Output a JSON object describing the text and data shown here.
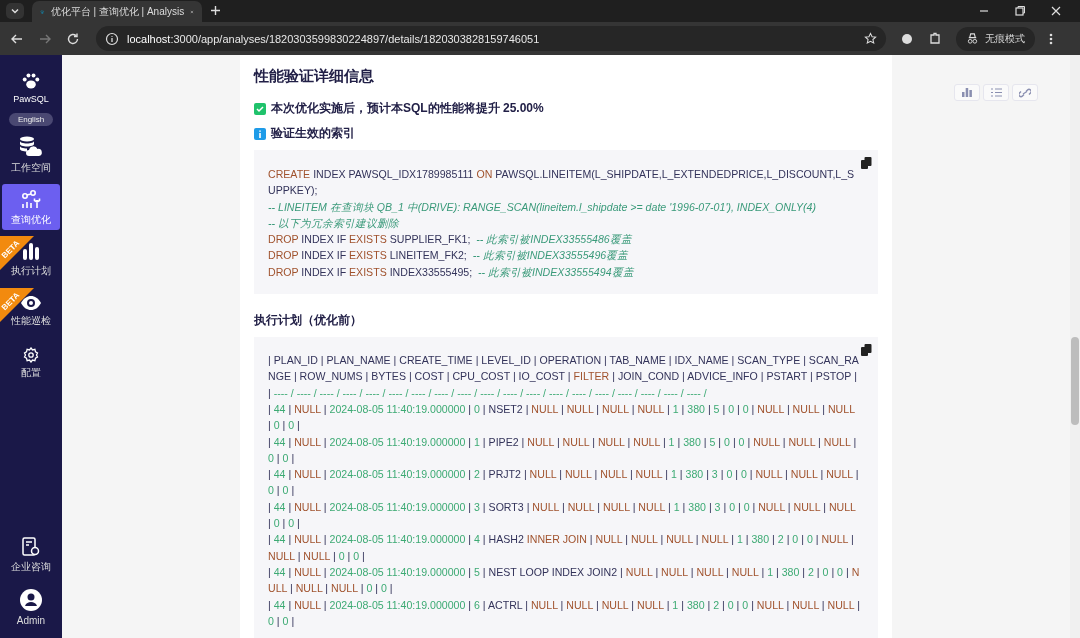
{
  "browser": {
    "tab_title": "优化平台 | 查询优化 | Analysis",
    "url_host": "localhost",
    "url_path": ":3000/app/analyses/1820303599830224897/details/1820303828159746051",
    "incognito_label": "无痕模式"
  },
  "sidebar": {
    "brand": "PawSQL",
    "language_button": "English",
    "items": [
      {
        "label": "工作空间",
        "selected": false
      },
      {
        "label": "查询优化",
        "selected": true
      },
      {
        "label": "执行计划",
        "selected": false,
        "badge": "BETA"
      },
      {
        "label": "性能巡检",
        "selected": false,
        "badge": "BETA"
      },
      {
        "label": "配置",
        "selected": false
      }
    ],
    "bottom_items": [
      {
        "label": "企业咨询"
      },
      {
        "label": "Admin"
      }
    ]
  },
  "content": {
    "title": "性能验证详细信息",
    "notices": [
      {
        "kind": "success",
        "text": "本次优化实施后，预计本SQL的性能将提升 25.00%"
      },
      {
        "kind": "info",
        "text": "验证生效的索引"
      }
    ],
    "index_sql": [
      [
        {
          "text": "CREATE",
          "kind": "keyword"
        },
        {
          "text": " INDEX PAWSQL_IDX1789985111 ",
          "kind": "plain"
        },
        {
          "text": "ON",
          "kind": "keyword"
        },
        {
          "text": " PAWSQL.LINEITEM(L_SHIPDATE,L_EXTENDEDPRICE,L_DISCOUNT,L_SUPPKEY);",
          "kind": "plain"
        }
      ],
      [
        {
          "text": "-- LINEITEM 在查询块 QB_1 中(DRIVE): RANGE_SCAN(lineitem.l_shipdate >= date '1996-07-01'), INDEX_ONLY(4)",
          "kind": "comment"
        }
      ],
      [
        {
          "text": "-- 以下为冗余索引建议删除",
          "kind": "comment"
        }
      ],
      [
        {
          "text": "DROP",
          "kind": "keyword"
        },
        {
          "text": " INDEX IF ",
          "kind": "plain"
        },
        {
          "text": "EXISTS",
          "kind": "keyword"
        },
        {
          "text": " SUPPLIER_FK1;  ",
          "kind": "plain"
        },
        {
          "text": "-- 此索引被INDEX33555486覆盖",
          "kind": "comment"
        }
      ],
      [
        {
          "text": "DROP",
          "kind": "keyword"
        },
        {
          "text": " INDEX IF ",
          "kind": "plain"
        },
        {
          "text": "EXISTS",
          "kind": "keyword"
        },
        {
          "text": " LINEITEM_FK2;  ",
          "kind": "plain"
        },
        {
          "text": "-- 此索引被INDEX33555496覆盖",
          "kind": "comment"
        }
      ],
      [
        {
          "text": "DROP",
          "kind": "keyword"
        },
        {
          "text": " INDEX IF ",
          "kind": "plain"
        },
        {
          "text": "EXISTS",
          "kind": "keyword"
        },
        {
          "text": " INDEX33555495;  ",
          "kind": "plain"
        },
        {
          "text": "-- 此索引被INDEX33555494覆盖",
          "kind": "comment"
        }
      ]
    ],
    "plan_title": "执行计划（优化前）",
    "plan_lines": [
      [
        {
          "text": "| PLAN_ID | PLAN_NAME | CREATE_TIME | LEVEL_ID | OPERATION | TAB_NAME | IDX_NAME | SCAN_TYPE | SCAN_RANGE | ROW_NUMS | BYTES | COST | CPU_COST | IO_COST | ",
          "kind": "plain"
        },
        {
          "text": "FILTER",
          "kind": "keyword"
        },
        {
          "text": " | JOIN_COND | ADVICE_INFO | PSTART | PSTOP |",
          "kind": "plain"
        }
      ],
      [
        {
          "text": "| ",
          "kind": "plain"
        },
        {
          "text": "---- / ---- / ---- / ---- / ---- / ---- / ---- / ---- / ---- / ---- / ---- / ---- / ---- / ---- / ---- / ---- / ---- / ---- / ---- /",
          "kind": "number"
        }
      ],
      [
        {
          "text": "| ",
          "kind": "plain"
        },
        {
          "text": "44",
          "kind": "number"
        },
        {
          "text": " | ",
          "kind": "plain"
        },
        {
          "text": "NULL",
          "kind": "keyword"
        },
        {
          "text": " | ",
          "kind": "plain"
        },
        {
          "text": "2024-08-05 11:40:19.000000",
          "kind": "number"
        },
        {
          "text": " | ",
          "kind": "plain"
        },
        {
          "text": "0",
          "kind": "number"
        },
        {
          "text": " | NSET2 | ",
          "kind": "plain"
        },
        {
          "text": "NULL",
          "kind": "keyword"
        },
        {
          "text": " | ",
          "kind": "plain"
        },
        {
          "text": "NULL",
          "kind": "keyword"
        },
        {
          "text": " | ",
          "kind": "plain"
        },
        {
          "text": "NULL",
          "kind": "keyword"
        },
        {
          "text": " | ",
          "kind": "plain"
        },
        {
          "text": "NULL",
          "kind": "keyword"
        },
        {
          "text": " | ",
          "kind": "plain"
        },
        {
          "text": "1",
          "kind": "number"
        },
        {
          "text": " | ",
          "kind": "plain"
        },
        {
          "text": "380",
          "kind": "number"
        },
        {
          "text": " | ",
          "kind": "plain"
        },
        {
          "text": "5",
          "kind": "number"
        },
        {
          "text": " | ",
          "kind": "plain"
        },
        {
          "text": "0",
          "kind": "number"
        },
        {
          "text": " | ",
          "kind": "plain"
        },
        {
          "text": "0",
          "kind": "number"
        },
        {
          "text": " | ",
          "kind": "plain"
        },
        {
          "text": "NULL",
          "kind": "keyword"
        },
        {
          "text": " | ",
          "kind": "plain"
        },
        {
          "text": "NULL",
          "kind": "keyword"
        },
        {
          "text": " | ",
          "kind": "plain"
        },
        {
          "text": "NULL",
          "kind": "keyword"
        },
        {
          "text": " | ",
          "kind": "plain"
        },
        {
          "text": "0",
          "kind": "number"
        },
        {
          "text": " | ",
          "kind": "plain"
        },
        {
          "text": "0",
          "kind": "number"
        },
        {
          "text": " |",
          "kind": "plain"
        }
      ],
      [
        {
          "text": "| ",
          "kind": "plain"
        },
        {
          "text": "44",
          "kind": "number"
        },
        {
          "text": " | ",
          "kind": "plain"
        },
        {
          "text": "NULL",
          "kind": "keyword"
        },
        {
          "text": " | ",
          "kind": "plain"
        },
        {
          "text": "2024-08-05 11:40:19.000000",
          "kind": "number"
        },
        {
          "text": " | ",
          "kind": "plain"
        },
        {
          "text": "1",
          "kind": "number"
        },
        {
          "text": " | PIPE2 | ",
          "kind": "plain"
        },
        {
          "text": "NULL",
          "kind": "keyword"
        },
        {
          "text": " | ",
          "kind": "plain"
        },
        {
          "text": "NULL",
          "kind": "keyword"
        },
        {
          "text": " | ",
          "kind": "plain"
        },
        {
          "text": "NULL",
          "kind": "keyword"
        },
        {
          "text": " | ",
          "kind": "plain"
        },
        {
          "text": "NULL",
          "kind": "keyword"
        },
        {
          "text": " | ",
          "kind": "plain"
        },
        {
          "text": "1",
          "kind": "number"
        },
        {
          "text": " | ",
          "kind": "plain"
        },
        {
          "text": "380",
          "kind": "number"
        },
        {
          "text": " | ",
          "kind": "plain"
        },
        {
          "text": "5",
          "kind": "number"
        },
        {
          "text": " | ",
          "kind": "plain"
        },
        {
          "text": "0",
          "kind": "number"
        },
        {
          "text": " | ",
          "kind": "plain"
        },
        {
          "text": "0",
          "kind": "number"
        },
        {
          "text": " | ",
          "kind": "plain"
        },
        {
          "text": "NULL",
          "kind": "keyword"
        },
        {
          "text": " | ",
          "kind": "plain"
        },
        {
          "text": "NULL",
          "kind": "keyword"
        },
        {
          "text": " | ",
          "kind": "plain"
        },
        {
          "text": "NULL",
          "kind": "keyword"
        },
        {
          "text": " | ",
          "kind": "plain"
        },
        {
          "text": "0",
          "kind": "number"
        },
        {
          "text": " | ",
          "kind": "plain"
        },
        {
          "text": "0",
          "kind": "number"
        },
        {
          "text": " |",
          "kind": "plain"
        }
      ],
      [
        {
          "text": "| ",
          "kind": "plain"
        },
        {
          "text": "44",
          "kind": "number"
        },
        {
          "text": " | ",
          "kind": "plain"
        },
        {
          "text": "NULL",
          "kind": "keyword"
        },
        {
          "text": " | ",
          "kind": "plain"
        },
        {
          "text": "2024-08-05 11:40:19.000000",
          "kind": "number"
        },
        {
          "text": " | ",
          "kind": "plain"
        },
        {
          "text": "2",
          "kind": "number"
        },
        {
          "text": " | PRJT2 | ",
          "kind": "plain"
        },
        {
          "text": "NULL",
          "kind": "keyword"
        },
        {
          "text": " | ",
          "kind": "plain"
        },
        {
          "text": "NULL",
          "kind": "keyword"
        },
        {
          "text": " | ",
          "kind": "plain"
        },
        {
          "text": "NULL",
          "kind": "keyword"
        },
        {
          "text": " | ",
          "kind": "plain"
        },
        {
          "text": "NULL",
          "kind": "keyword"
        },
        {
          "text": " | ",
          "kind": "plain"
        },
        {
          "text": "1",
          "kind": "number"
        },
        {
          "text": " | ",
          "kind": "plain"
        },
        {
          "text": "380",
          "kind": "number"
        },
        {
          "text": " | ",
          "kind": "plain"
        },
        {
          "text": "3",
          "kind": "number"
        },
        {
          "text": " | ",
          "kind": "plain"
        },
        {
          "text": "0",
          "kind": "number"
        },
        {
          "text": " | ",
          "kind": "plain"
        },
        {
          "text": "0",
          "kind": "number"
        },
        {
          "text": " | ",
          "kind": "plain"
        },
        {
          "text": "NULL",
          "kind": "keyword"
        },
        {
          "text": " | ",
          "kind": "plain"
        },
        {
          "text": "NULL",
          "kind": "keyword"
        },
        {
          "text": " | ",
          "kind": "plain"
        },
        {
          "text": "NULL",
          "kind": "keyword"
        },
        {
          "text": " | ",
          "kind": "plain"
        },
        {
          "text": "0",
          "kind": "number"
        },
        {
          "text": " | ",
          "kind": "plain"
        },
        {
          "text": "0",
          "kind": "number"
        },
        {
          "text": " |",
          "kind": "plain"
        }
      ],
      [
        {
          "text": "| ",
          "kind": "plain"
        },
        {
          "text": "44",
          "kind": "number"
        },
        {
          "text": " | ",
          "kind": "plain"
        },
        {
          "text": "NULL",
          "kind": "keyword"
        },
        {
          "text": " | ",
          "kind": "plain"
        },
        {
          "text": "2024-08-05 11:40:19.000000",
          "kind": "number"
        },
        {
          "text": " | ",
          "kind": "plain"
        },
        {
          "text": "3",
          "kind": "number"
        },
        {
          "text": " | SORT3 | ",
          "kind": "plain"
        },
        {
          "text": "NULL",
          "kind": "keyword"
        },
        {
          "text": " | ",
          "kind": "plain"
        },
        {
          "text": "NULL",
          "kind": "keyword"
        },
        {
          "text": " | ",
          "kind": "plain"
        },
        {
          "text": "NULL",
          "kind": "keyword"
        },
        {
          "text": " | ",
          "kind": "plain"
        },
        {
          "text": "NULL",
          "kind": "keyword"
        },
        {
          "text": " | ",
          "kind": "plain"
        },
        {
          "text": "1",
          "kind": "number"
        },
        {
          "text": " | ",
          "kind": "plain"
        },
        {
          "text": "380",
          "kind": "number"
        },
        {
          "text": " | ",
          "kind": "plain"
        },
        {
          "text": "3",
          "kind": "number"
        },
        {
          "text": " | ",
          "kind": "plain"
        },
        {
          "text": "0",
          "kind": "number"
        },
        {
          "text": " | ",
          "kind": "plain"
        },
        {
          "text": "0",
          "kind": "number"
        },
        {
          "text": " | ",
          "kind": "plain"
        },
        {
          "text": "NULL",
          "kind": "keyword"
        },
        {
          "text": " | ",
          "kind": "plain"
        },
        {
          "text": "NULL",
          "kind": "keyword"
        },
        {
          "text": " | ",
          "kind": "plain"
        },
        {
          "text": "NULL",
          "kind": "keyword"
        },
        {
          "text": " | ",
          "kind": "plain"
        },
        {
          "text": "0",
          "kind": "number"
        },
        {
          "text": " | ",
          "kind": "plain"
        },
        {
          "text": "0",
          "kind": "number"
        },
        {
          "text": " |",
          "kind": "plain"
        }
      ],
      [
        {
          "text": "| ",
          "kind": "plain"
        },
        {
          "text": "44",
          "kind": "number"
        },
        {
          "text": " | ",
          "kind": "plain"
        },
        {
          "text": "NULL",
          "kind": "keyword"
        },
        {
          "text": " | ",
          "kind": "plain"
        },
        {
          "text": "2024-08-05 11:40:19.000000",
          "kind": "number"
        },
        {
          "text": " | ",
          "kind": "plain"
        },
        {
          "text": "4",
          "kind": "number"
        },
        {
          "text": " | HASH2 ",
          "kind": "plain"
        },
        {
          "text": "INNER JOIN",
          "kind": "keyword"
        },
        {
          "text": " | ",
          "kind": "plain"
        },
        {
          "text": "NULL",
          "kind": "keyword"
        },
        {
          "text": " | ",
          "kind": "plain"
        },
        {
          "text": "NULL",
          "kind": "keyword"
        },
        {
          "text": " | ",
          "kind": "plain"
        },
        {
          "text": "NULL",
          "kind": "keyword"
        },
        {
          "text": " | ",
          "kind": "plain"
        },
        {
          "text": "NULL",
          "kind": "keyword"
        },
        {
          "text": " | ",
          "kind": "plain"
        },
        {
          "text": "1",
          "kind": "number"
        },
        {
          "text": " | ",
          "kind": "plain"
        },
        {
          "text": "380",
          "kind": "number"
        },
        {
          "text": " | ",
          "kind": "plain"
        },
        {
          "text": "2",
          "kind": "number"
        },
        {
          "text": " | ",
          "kind": "plain"
        },
        {
          "text": "0",
          "kind": "number"
        },
        {
          "text": " | ",
          "kind": "plain"
        },
        {
          "text": "0",
          "kind": "number"
        },
        {
          "text": " | ",
          "kind": "plain"
        },
        {
          "text": "NULL",
          "kind": "keyword"
        },
        {
          "text": " | ",
          "kind": "plain"
        },
        {
          "text": "NULL",
          "kind": "keyword"
        },
        {
          "text": " | ",
          "kind": "plain"
        },
        {
          "text": "NULL",
          "kind": "keyword"
        },
        {
          "text": " | ",
          "kind": "plain"
        },
        {
          "text": "0",
          "kind": "number"
        },
        {
          "text": " | ",
          "kind": "plain"
        },
        {
          "text": "0",
          "kind": "number"
        },
        {
          "text": " |",
          "kind": "plain"
        }
      ],
      [
        {
          "text": "| ",
          "kind": "plain"
        },
        {
          "text": "44",
          "kind": "number"
        },
        {
          "text": " | ",
          "kind": "plain"
        },
        {
          "text": "NULL",
          "kind": "keyword"
        },
        {
          "text": " | ",
          "kind": "plain"
        },
        {
          "text": "2024-08-05 11:40:19.000000",
          "kind": "number"
        },
        {
          "text": " | ",
          "kind": "plain"
        },
        {
          "text": "5",
          "kind": "number"
        },
        {
          "text": " | NEST LOOP INDEX JOIN2 | ",
          "kind": "plain"
        },
        {
          "text": "NULL",
          "kind": "keyword"
        },
        {
          "text": " | ",
          "kind": "plain"
        },
        {
          "text": "NULL",
          "kind": "keyword"
        },
        {
          "text": " | ",
          "kind": "plain"
        },
        {
          "text": "NULL",
          "kind": "keyword"
        },
        {
          "text": " | ",
          "kind": "plain"
        },
        {
          "text": "NULL",
          "kind": "keyword"
        },
        {
          "text": " | ",
          "kind": "plain"
        },
        {
          "text": "1",
          "kind": "number"
        },
        {
          "text": " | ",
          "kind": "plain"
        },
        {
          "text": "380",
          "kind": "number"
        },
        {
          "text": " | ",
          "kind": "plain"
        },
        {
          "text": "2",
          "kind": "number"
        },
        {
          "text": " | ",
          "kind": "plain"
        },
        {
          "text": "0",
          "kind": "number"
        },
        {
          "text": " | ",
          "kind": "plain"
        },
        {
          "text": "0",
          "kind": "number"
        },
        {
          "text": " | ",
          "kind": "plain"
        },
        {
          "text": "NULL",
          "kind": "keyword"
        },
        {
          "text": " | ",
          "kind": "plain"
        },
        {
          "text": "NULL",
          "kind": "keyword"
        },
        {
          "text": " | ",
          "kind": "plain"
        },
        {
          "text": "NULL",
          "kind": "keyword"
        },
        {
          "text": " | ",
          "kind": "plain"
        },
        {
          "text": "0",
          "kind": "number"
        },
        {
          "text": " | ",
          "kind": "plain"
        },
        {
          "text": "0",
          "kind": "number"
        },
        {
          "text": " |",
          "kind": "plain"
        }
      ],
      [
        {
          "text": "| ",
          "kind": "plain"
        },
        {
          "text": "44",
          "kind": "number"
        },
        {
          "text": " | ",
          "kind": "plain"
        },
        {
          "text": "NULL",
          "kind": "keyword"
        },
        {
          "text": " | ",
          "kind": "plain"
        },
        {
          "text": "2024-08-05 11:40:19.000000",
          "kind": "number"
        },
        {
          "text": " | ",
          "kind": "plain"
        },
        {
          "text": "6",
          "kind": "number"
        },
        {
          "text": " | ACTRL | ",
          "kind": "plain"
        },
        {
          "text": "NULL",
          "kind": "keyword"
        },
        {
          "text": " | ",
          "kind": "plain"
        },
        {
          "text": "NULL",
          "kind": "keyword"
        },
        {
          "text": " | ",
          "kind": "plain"
        },
        {
          "text": "NULL",
          "kind": "keyword"
        },
        {
          "text": " | ",
          "kind": "plain"
        },
        {
          "text": "NULL",
          "kind": "keyword"
        },
        {
          "text": " | ",
          "kind": "plain"
        },
        {
          "text": "1",
          "kind": "number"
        },
        {
          "text": " | ",
          "kind": "plain"
        },
        {
          "text": "380",
          "kind": "number"
        },
        {
          "text": " | ",
          "kind": "plain"
        },
        {
          "text": "2",
          "kind": "number"
        },
        {
          "text": " | ",
          "kind": "plain"
        },
        {
          "text": "0",
          "kind": "number"
        },
        {
          "text": " | ",
          "kind": "plain"
        },
        {
          "text": "0",
          "kind": "number"
        },
        {
          "text": " | ",
          "kind": "plain"
        },
        {
          "text": "NULL",
          "kind": "keyword"
        },
        {
          "text": " | ",
          "kind": "plain"
        },
        {
          "text": "NULL",
          "kind": "keyword"
        },
        {
          "text": " | ",
          "kind": "plain"
        },
        {
          "text": "NULL",
          "kind": "keyword"
        },
        {
          "text": " | ",
          "kind": "plain"
        },
        {
          "text": "0",
          "kind": "number"
        },
        {
          "text": " | ",
          "kind": "plain"
        },
        {
          "text": "0",
          "kind": "number"
        },
        {
          "text": " |",
          "kind": "plain"
        }
      ]
    ]
  }
}
